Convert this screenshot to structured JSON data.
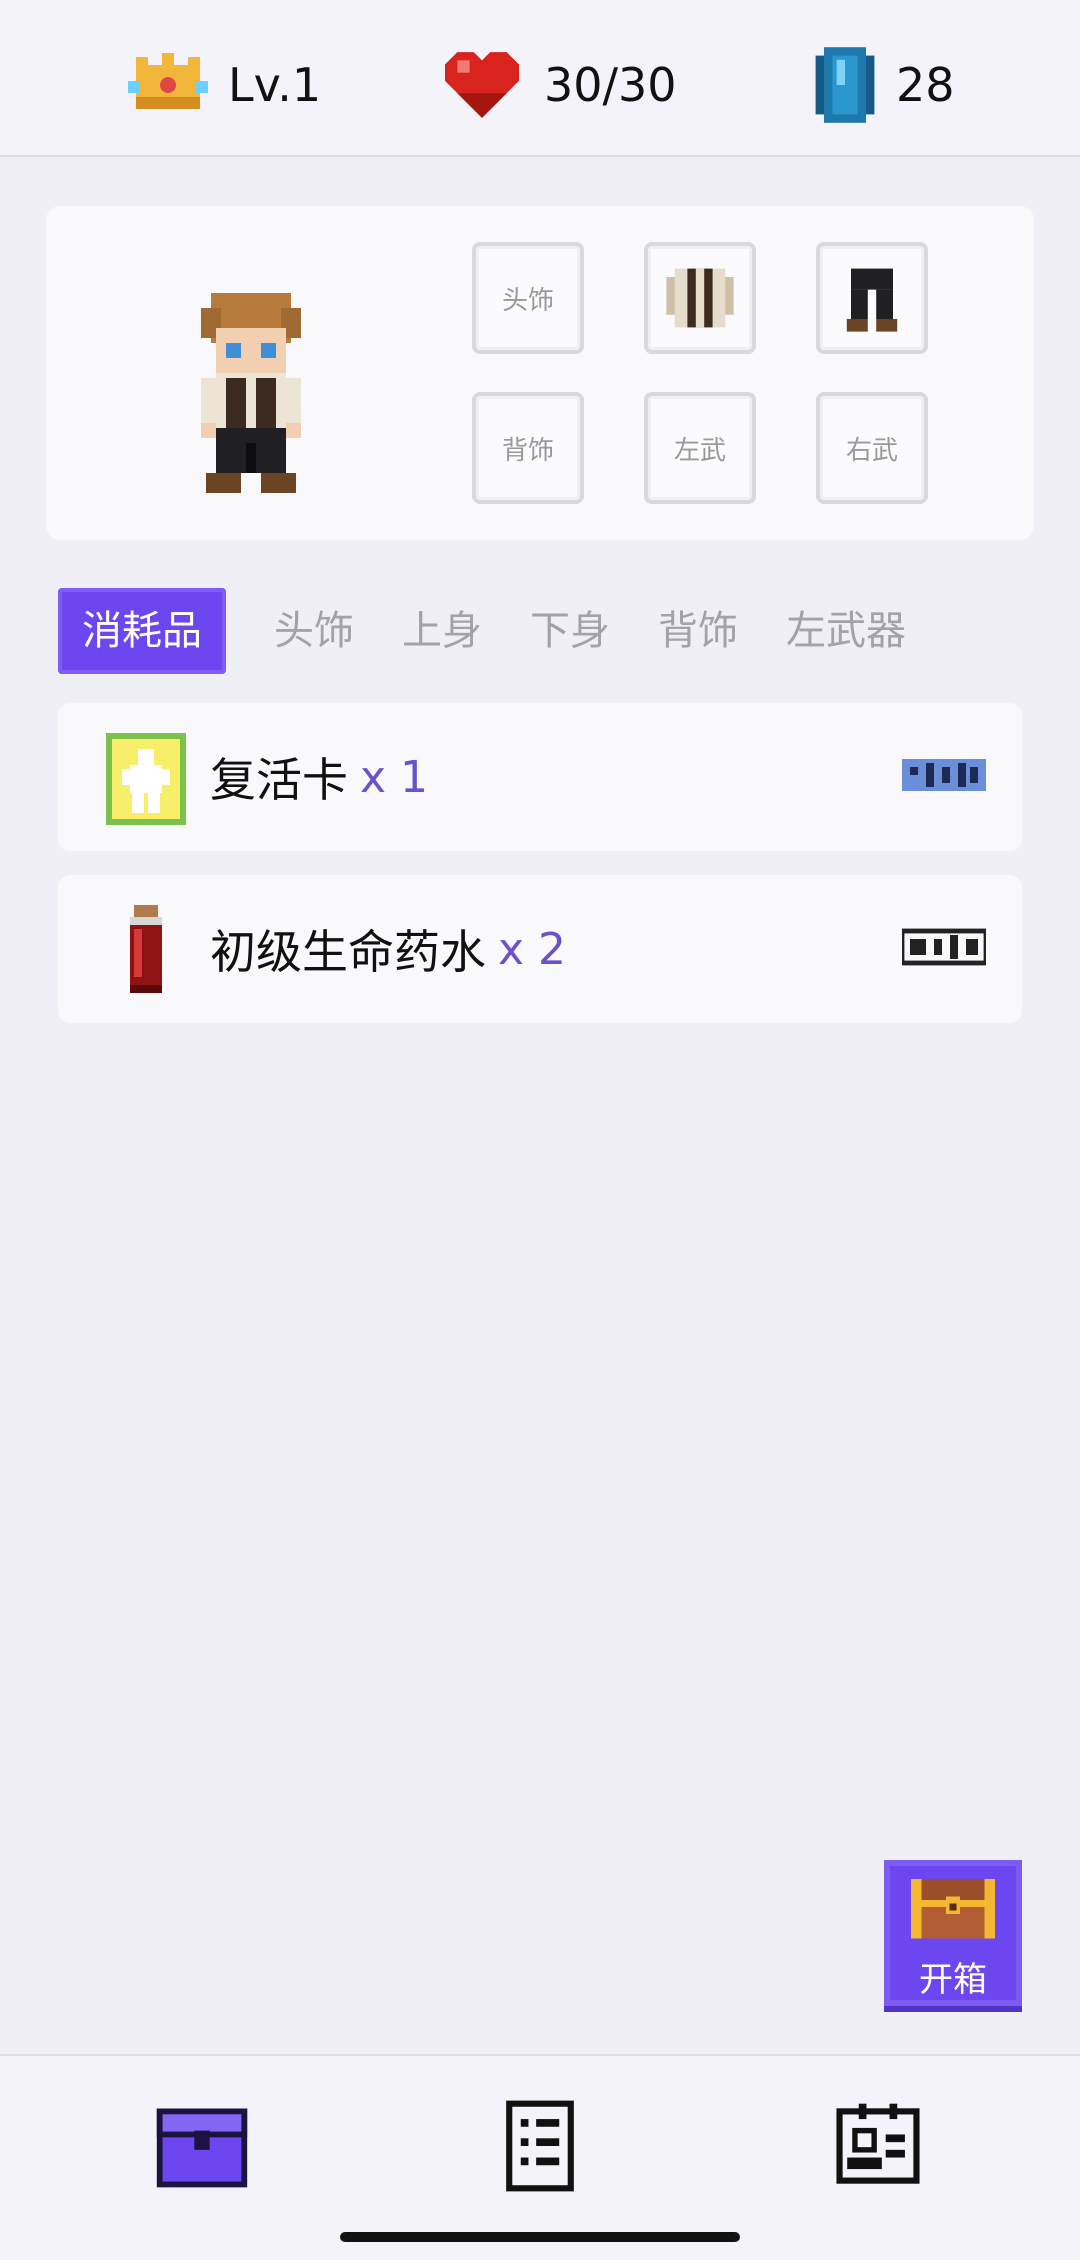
{
  "status": {
    "level": "Lv.1",
    "hp": "30/30",
    "gems": "28",
    "icons": [
      "crown-icon",
      "heart-icon",
      "gem-icon"
    ]
  },
  "equipment": {
    "slots": {
      "head": "头饰",
      "top": "",
      "bottom": "",
      "back": "背饰",
      "left_weapon": "左武",
      "right_weapon": "右武"
    }
  },
  "tabs": [
    "消耗品",
    "头饰",
    "上身",
    "下身",
    "背饰",
    "左武器"
  ],
  "active_tab": "消耗品",
  "items": [
    {
      "name": "复活卡",
      "qty": "x 1",
      "icon": "revive-card-icon",
      "tag_color": "#6a8fd8"
    },
    {
      "name": "初级生命药水",
      "qty": "x 2",
      "icon": "health-potion-icon",
      "tag_color": "#222222"
    }
  ],
  "open_chest": {
    "label": "开箱"
  },
  "nav": [
    "bag-icon",
    "list-icon",
    "profile-icon"
  ],
  "colors": {
    "accent": "#6c47f0",
    "qty": "#6c52c8"
  }
}
